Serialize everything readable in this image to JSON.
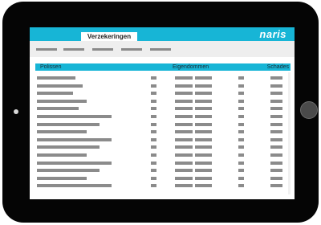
{
  "app": {
    "logo": "naris",
    "active_tab": "Verzekeringen"
  },
  "table": {
    "headers": [
      "Polissen",
      "Eigendommen",
      "Schades"
    ],
    "row_count": 15
  },
  "colors": {
    "accent": "#17b5d6",
    "bezel": "#050505",
    "placeholder": "#8b8b8b"
  }
}
